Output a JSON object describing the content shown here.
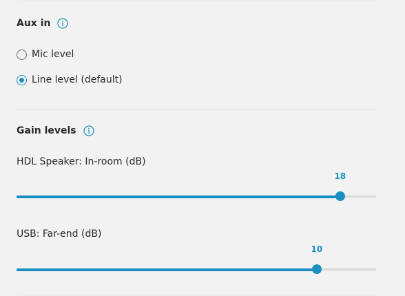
{
  "aux_in": {
    "title": "Aux in",
    "info_icon": "info-circle-icon",
    "options": [
      {
        "label": "Mic level",
        "selected": false
      },
      {
        "label": "Line level (default)",
        "selected": true
      }
    ]
  },
  "gain_levels": {
    "title": "Gain levels",
    "info_icon": "info-circle-icon",
    "sliders": [
      {
        "label": "HDL Speaker: In-room (dB)",
        "value": "18",
        "fill_fraction": 0.9
      },
      {
        "label": "USB: Far-end (dB)",
        "value": "10",
        "fill_fraction": 0.835
      }
    ]
  },
  "colors": {
    "accent": "#1a8fc0",
    "track": "#d9d9d9",
    "background": "#f2f2f2",
    "divider": "#dcdcdc"
  }
}
